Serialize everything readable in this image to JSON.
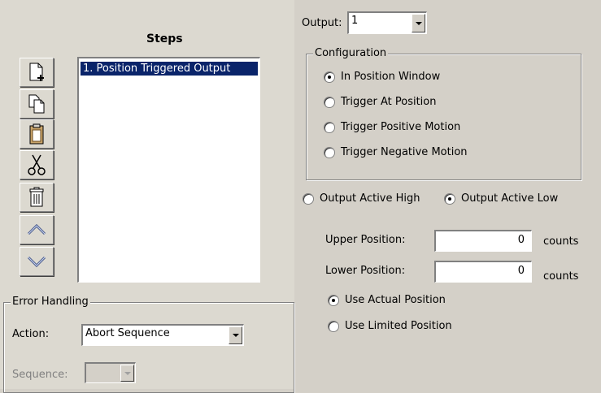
{
  "steps": {
    "title": "Steps",
    "items": [
      "1. Position Triggered Output"
    ],
    "toolbar": [
      {
        "name": "new-step-button",
        "icon": "new-document-icon"
      },
      {
        "name": "copy-step-button",
        "icon": "copy-icon"
      },
      {
        "name": "paste-step-button",
        "icon": "clipboard-icon"
      },
      {
        "name": "cut-step-button",
        "icon": "scissors-icon"
      },
      {
        "name": "delete-step-button",
        "icon": "trash-icon"
      },
      {
        "name": "move-up-button",
        "icon": "chevron-up-icon"
      },
      {
        "name": "move-down-button",
        "icon": "chevron-down-icon"
      }
    ]
  },
  "error_handling": {
    "title": "Error Handling",
    "action_label": "Action:",
    "action_value": "Abort Sequence",
    "sequence_label": "Sequence:",
    "sequence_value": ""
  },
  "output": {
    "label": "Output:",
    "value": "1"
  },
  "configuration": {
    "title": "Configuration",
    "options": [
      {
        "label": "In Position Window",
        "selected": true
      },
      {
        "label": "Trigger At Position",
        "selected": false
      },
      {
        "label": "Trigger Positive Motion",
        "selected": false
      },
      {
        "label": "Trigger Negative Motion",
        "selected": false
      }
    ]
  },
  "polarity": {
    "active_high": "Output Active High",
    "active_low": "Output Active Low",
    "selected": "low"
  },
  "positions": {
    "upper_label": "Upper Position:",
    "upper_value": "0",
    "lower_label": "Lower Position:",
    "lower_value": "0",
    "unit": "counts"
  },
  "position_source": {
    "actual": "Use Actual Position",
    "limited": "Use Limited Position",
    "selected": "actual"
  }
}
